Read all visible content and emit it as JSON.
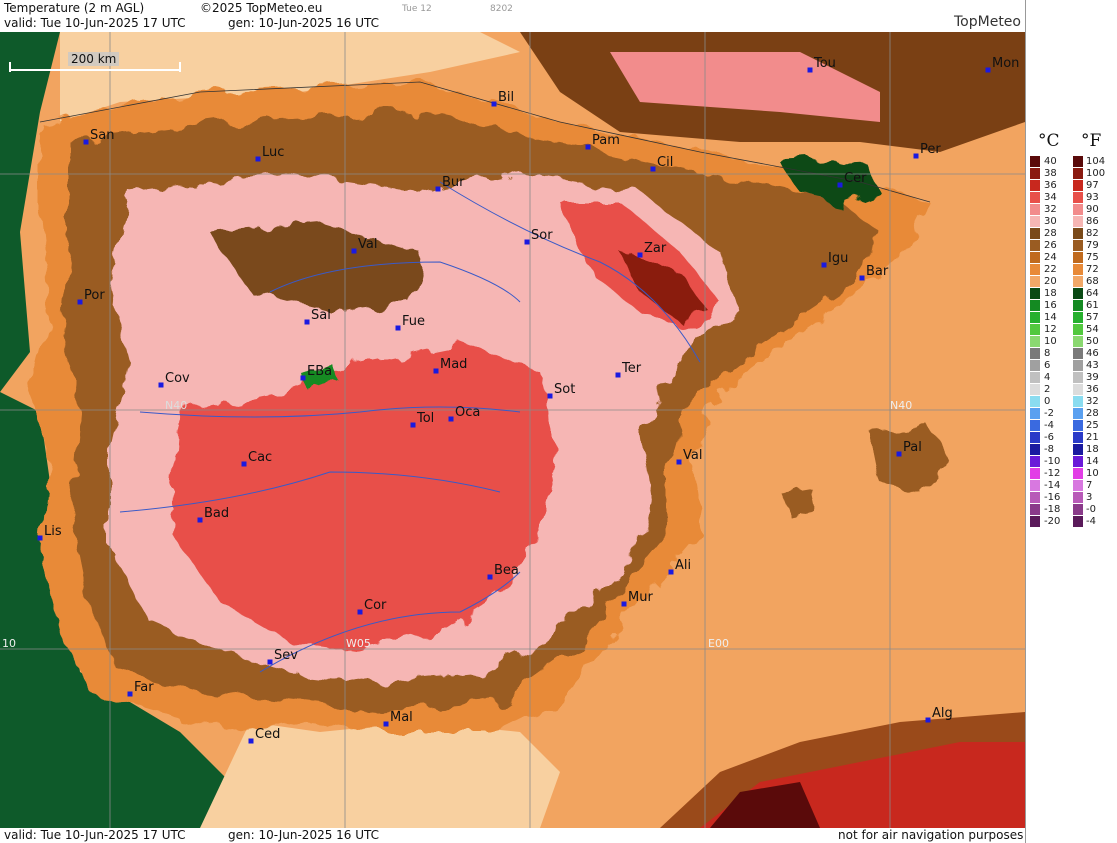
{
  "header": {
    "title": "Temperature (2 m AGL)",
    "copyright": "©2025 TopMeteo.eu",
    "day_code": "Tue 12",
    "code": "8202",
    "valid": "valid:  Tue  10-Jun-2025  17 UTC",
    "gen": "gen: 10-Jun-2025 16 UTC",
    "brand": "TopMeteo"
  },
  "footer": {
    "valid": "valid:  Tue  10-Jun-2025  17 UTC",
    "gen": "gen: 10-Jun-2025 16 UTC",
    "note": "not for air navigation purposes"
  },
  "scale_bar": "200 km",
  "grid_labels": {
    "n40_left": "N40",
    "n40_right": "N40",
    "w10": "10",
    "w05": "W05",
    "e00": "E00"
  },
  "cities": [
    {
      "name": "San"
    },
    {
      "name": "Luc"
    },
    {
      "name": "Bil"
    },
    {
      "name": "Pam"
    },
    {
      "name": "Tou"
    },
    {
      "name": "Mon"
    },
    {
      "name": "Cil"
    },
    {
      "name": "Per"
    },
    {
      "name": "Cer"
    },
    {
      "name": "Bur"
    },
    {
      "name": "Val"
    },
    {
      "name": "Sor"
    },
    {
      "name": "Zar"
    },
    {
      "name": "Igu"
    },
    {
      "name": "Bar"
    },
    {
      "name": "Por"
    },
    {
      "name": "Sal"
    },
    {
      "name": "Fue"
    },
    {
      "name": "Mad"
    },
    {
      "name": "EBa"
    },
    {
      "name": "Cov"
    },
    {
      "name": "Ter"
    },
    {
      "name": "Sot"
    },
    {
      "name": "Tol"
    },
    {
      "name": "Oca"
    },
    {
      "name": "Cac"
    },
    {
      "name": "Val"
    },
    {
      "name": "Pal"
    },
    {
      "name": "Bad"
    },
    {
      "name": "Lis"
    },
    {
      "name": "Ali"
    },
    {
      "name": "Bea"
    },
    {
      "name": "Mur"
    },
    {
      "name": "Cor"
    },
    {
      "name": "Sev"
    },
    {
      "name": "Far"
    },
    {
      "name": "Mal"
    },
    {
      "name": "Ced"
    },
    {
      "name": "Alg"
    }
  ],
  "legend": {
    "unit_c": "°C",
    "unit_f": "°F",
    "celsius": [
      "40",
      "38",
      "36",
      "34",
      "32",
      "30",
      "28",
      "26",
      "24",
      "22",
      "20",
      "18",
      "16",
      "14",
      "12",
      "10",
      "8",
      "6",
      "4",
      "2",
      "0",
      "-2",
      "-4",
      "-6",
      "-8",
      "-10",
      "-12",
      "-14",
      "-16",
      "-18",
      "-20"
    ],
    "fahrenheit": [
      "104",
      "100",
      "97",
      "93",
      "90",
      "86",
      "82",
      "79",
      "75",
      "72",
      "68",
      "64",
      "61",
      "57",
      "54",
      "50",
      "46",
      "43",
      "39",
      "36",
      "32",
      "28",
      "25",
      "21",
      "18",
      "14",
      "10",
      "7",
      "3",
      "-0",
      "-4"
    ],
    "colors": [
      "#5a0a0a",
      "#8a1a10",
      "#c8281e",
      "#e8504a",
      "#f28c8c",
      "#f6b6b4",
      "#7a4a1a",
      "#9a5c22",
      "#c06a1e",
      "#e88a38",
      "#f2a868",
      "#0a4a14",
      "#148a22",
      "#26b02e",
      "#52c83e",
      "#8ad870",
      "#7a7a7a",
      "#a0a0a0",
      "#c0c0c0",
      "#dcdcdc",
      "#8adcf0",
      "#5aa0f0",
      "#3a6ae0",
      "#2a3ac8",
      "#1a1aa0",
      "#6a1ad8",
      "#e23ee6",
      "#d878e0",
      "#b85ab8",
      "#8a3a8a",
      "#5a1a5a"
    ]
  }
}
